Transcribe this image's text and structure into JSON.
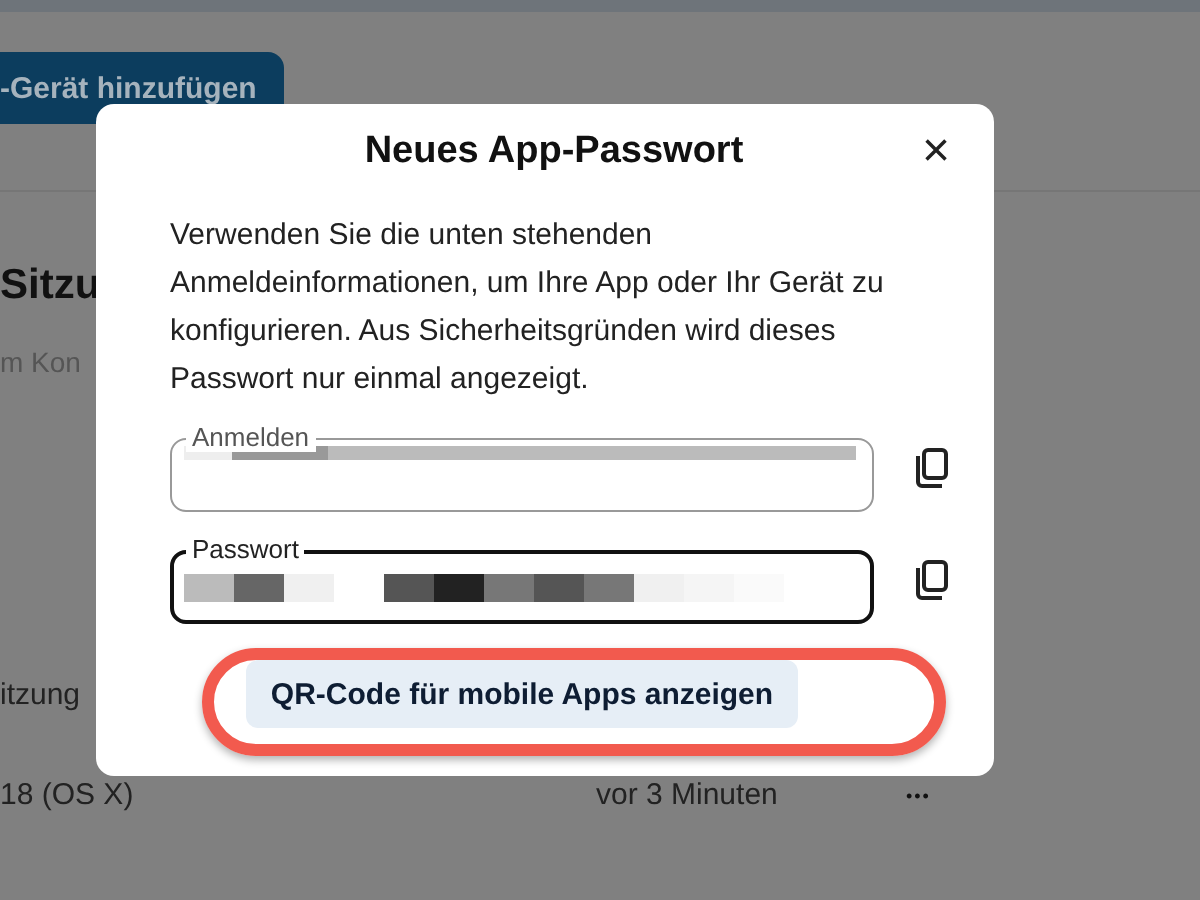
{
  "background_page": {
    "add_button": "-Gerät hinzufügen",
    "section_title": "Sitzu",
    "section_subtitle": "m Kon",
    "row_label": "itzung",
    "session": {
      "device": "18 (OS X)",
      "time": "vor 3 Minuten",
      "menu": "•••"
    }
  },
  "dialog": {
    "title": "Neues App-Passwort",
    "close": "×",
    "description": "Verwenden Sie die unten stehenden Anmeldeinformationen, um Ihre App oder Ihr Gerät zu konfigurieren. Aus Sicherheitsgründen wird dieses Passwort nur einmal angezeigt.",
    "fields": [
      {
        "label": "Anmelden",
        "focused": false
      },
      {
        "label": "Passwort",
        "focused": true
      }
    ],
    "qr_button": "QR-Code für mobile Apps anzeigen",
    "qr_button_highlighted": true
  }
}
